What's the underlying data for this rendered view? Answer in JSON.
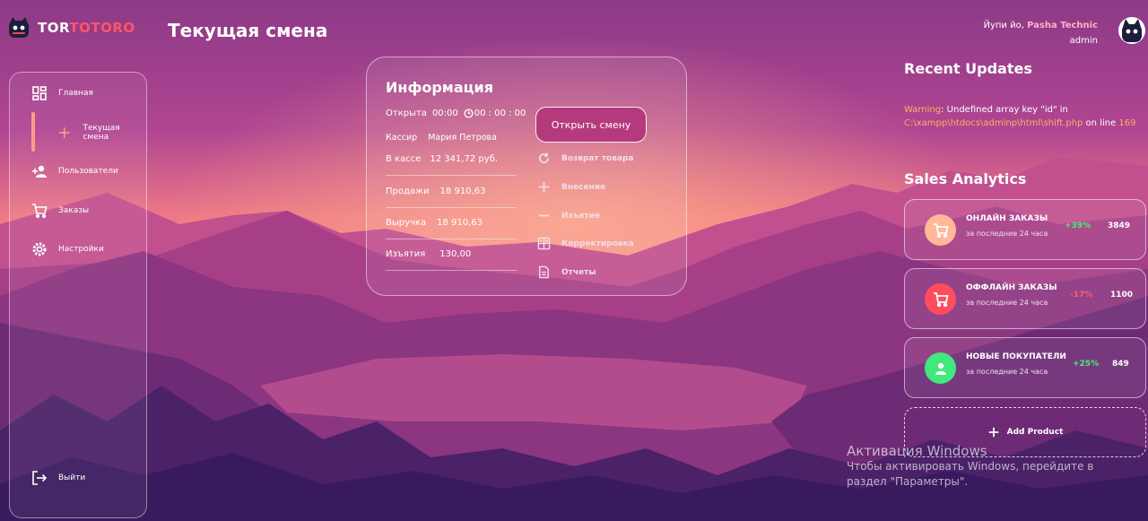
{
  "brand": {
    "part1": "TOR",
    "part2": "TOTORO"
  },
  "page_title": "Текущая смена",
  "user": {
    "greeting": "Йупи йо, ",
    "name": "Pasha Technic",
    "role": "admin"
  },
  "sidebar": {
    "items": [
      {
        "label": "Главная",
        "icon": "dashboard-icon"
      },
      {
        "label": "Текущая смена",
        "icon": "plus-icon"
      },
      {
        "label": "Пользователи",
        "icon": "add-user-icon"
      },
      {
        "label": "Заказы",
        "icon": "cart-icon"
      },
      {
        "label": "Настройки",
        "icon": "gear-icon"
      }
    ],
    "logout": {
      "label": "Выйти",
      "icon": "logout-icon"
    }
  },
  "info": {
    "title": "Информация",
    "opened_label": "Открыта",
    "opened_time": "00:00",
    "timer": "00 : 00 : 00",
    "cashier_label": "Кассир",
    "cashier_name": "Мария Петрова",
    "in_cash_label": "В кассе",
    "in_cash_value": "12 341,72 руб.",
    "sales_label": "Продажи",
    "sales_value": "18 910,63",
    "revenue_label": "Выручка",
    "revenue_value": "18 910,63",
    "withdrawals_label": "Изъятия",
    "withdrawals_value": "130,00",
    "open_shift_button": "Открыть смену",
    "actions": [
      {
        "label": "Возврат товара",
        "icon": "refresh-icon"
      },
      {
        "label": "Внесение",
        "icon": "plus-icon"
      },
      {
        "label": "Изъятие",
        "icon": "minus-icon"
      },
      {
        "label": "Корректировка",
        "icon": "calculator-icon"
      },
      {
        "label": "Отчеты",
        "icon": "document-icon"
      }
    ]
  },
  "recent_updates": {
    "title": "Recent Updates",
    "warning_word": "Warning",
    "warning_text": ": Undefined array key \"id\" in",
    "path": "C:\\xampp\\htdocs\\adminp\\html\\shift.php",
    "on_line": " on line ",
    "line": "169"
  },
  "sales_analytics": {
    "title": "Sales Analytics",
    "cards": [
      {
        "name": "ОНЛАЙН ЗАКАЗЫ",
        "sub": "за последние 24 часа",
        "pct": "+39%",
        "count": "3849",
        "icon": "cart-icon",
        "icon_bg": "#ffb89a",
        "pct_color": "#41f07a"
      },
      {
        "name": "ОФФЛАЙН ЗАКАЗЫ",
        "sub": "за последние 24 часа",
        "pct": "-17%",
        "count": "1100",
        "icon": "cart-icon",
        "icon_bg": "#ff4d5e",
        "pct_color": "#ff5b6d"
      },
      {
        "name": "НОВЫЕ ПОКУПАТЕЛИ",
        "sub": "за последние 24 часа",
        "pct": "+25%",
        "count": "849",
        "icon": "user-icon",
        "icon_bg": "#41e87a",
        "pct_color": "#41f07a"
      }
    ],
    "add_product": "Add Product"
  },
  "windows_watermark": {
    "title": "Активация Windows",
    "line1": "Чтобы активировать Windows, перейдите в",
    "line2": "раздел \"Параметры\"."
  }
}
